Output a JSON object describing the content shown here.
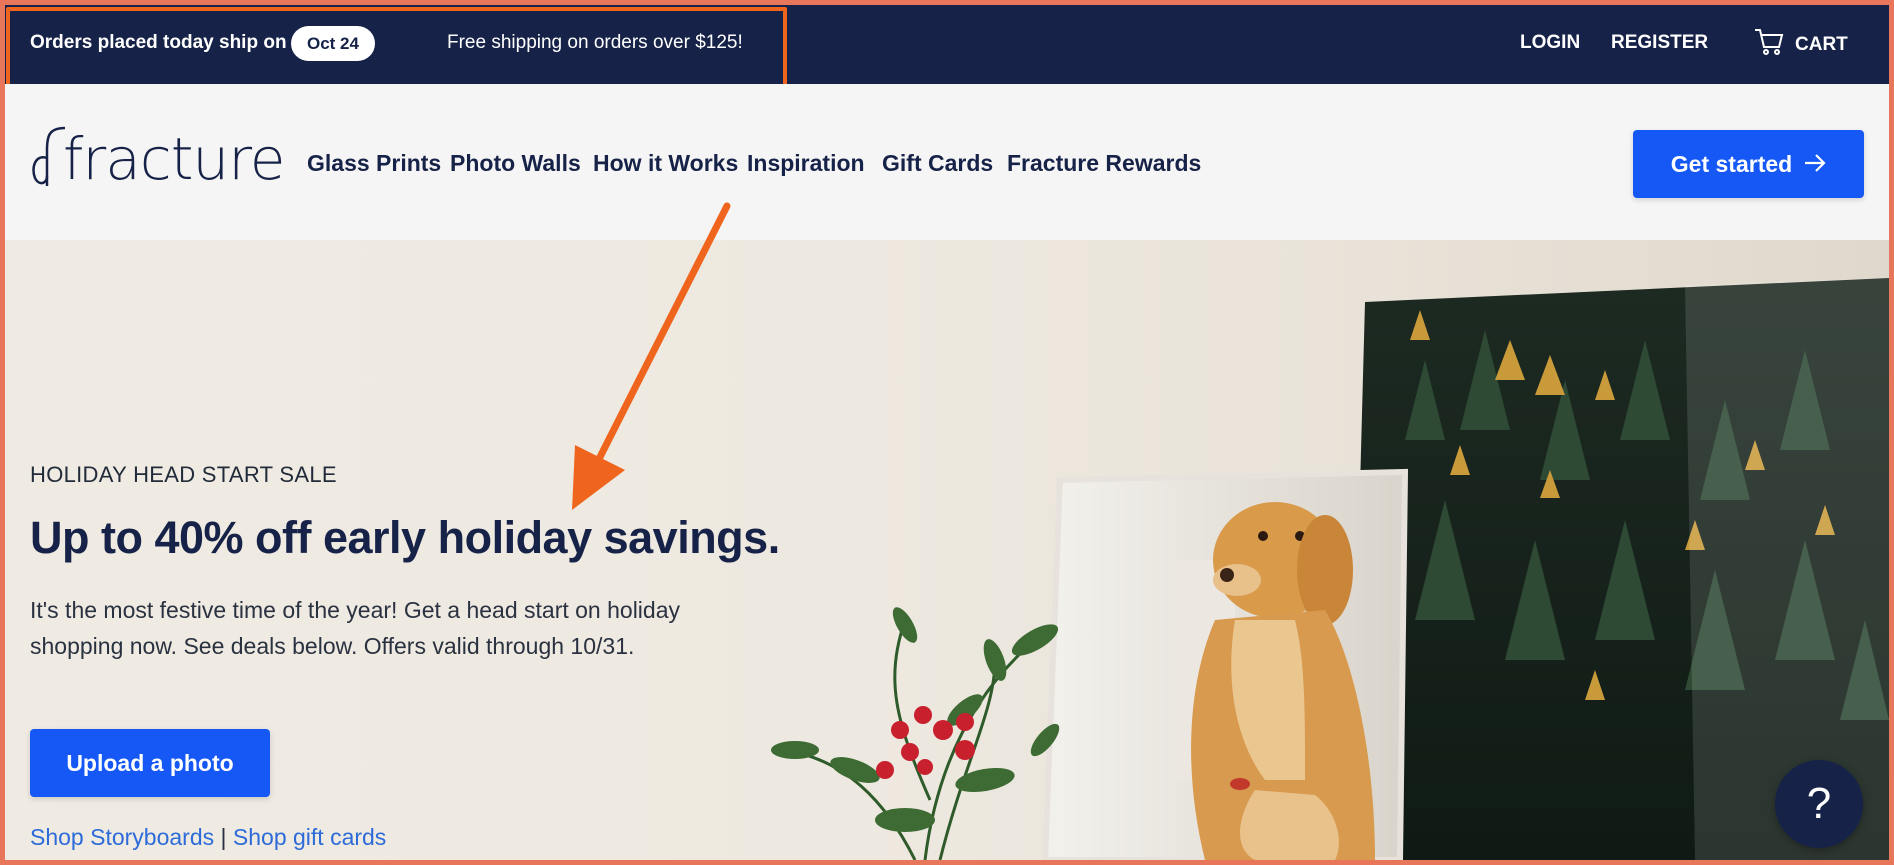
{
  "topbar": {
    "ship_label": "Orders placed today ship on",
    "ship_date": "Oct 24",
    "free_shipping": "Free shipping on orders over $125!",
    "login": "LOGIN",
    "register": "REGISTER",
    "cart": "CART"
  },
  "nav": {
    "logo": "fracture",
    "items": [
      "Glass Prints",
      "Photo Walls",
      "How it Works",
      "Inspiration",
      "Gift Cards",
      "Fracture Rewards"
    ],
    "cta": "Get started"
  },
  "hero": {
    "eyebrow": "HOLIDAY HEAD START SALE",
    "headline": "Up to 40% off early holiday savings.",
    "description": "It's the most festive time of the year! Get a head start on holiday shopping now. See deals below. Offers valid through 10/31.",
    "upload_button": "Upload a photo",
    "link_storyboards": "Shop Storyboards",
    "link_separator": "|",
    "link_giftcards": "Shop gift cards"
  },
  "help_button": "?",
  "colors": {
    "navy": "#162247",
    "brand_blue": "#1558f5",
    "annotation_orange": "#f0651e",
    "link_blue": "#2d6bd9"
  },
  "icons": [
    "cart-icon",
    "arrow-right-icon",
    "help-icon"
  ]
}
